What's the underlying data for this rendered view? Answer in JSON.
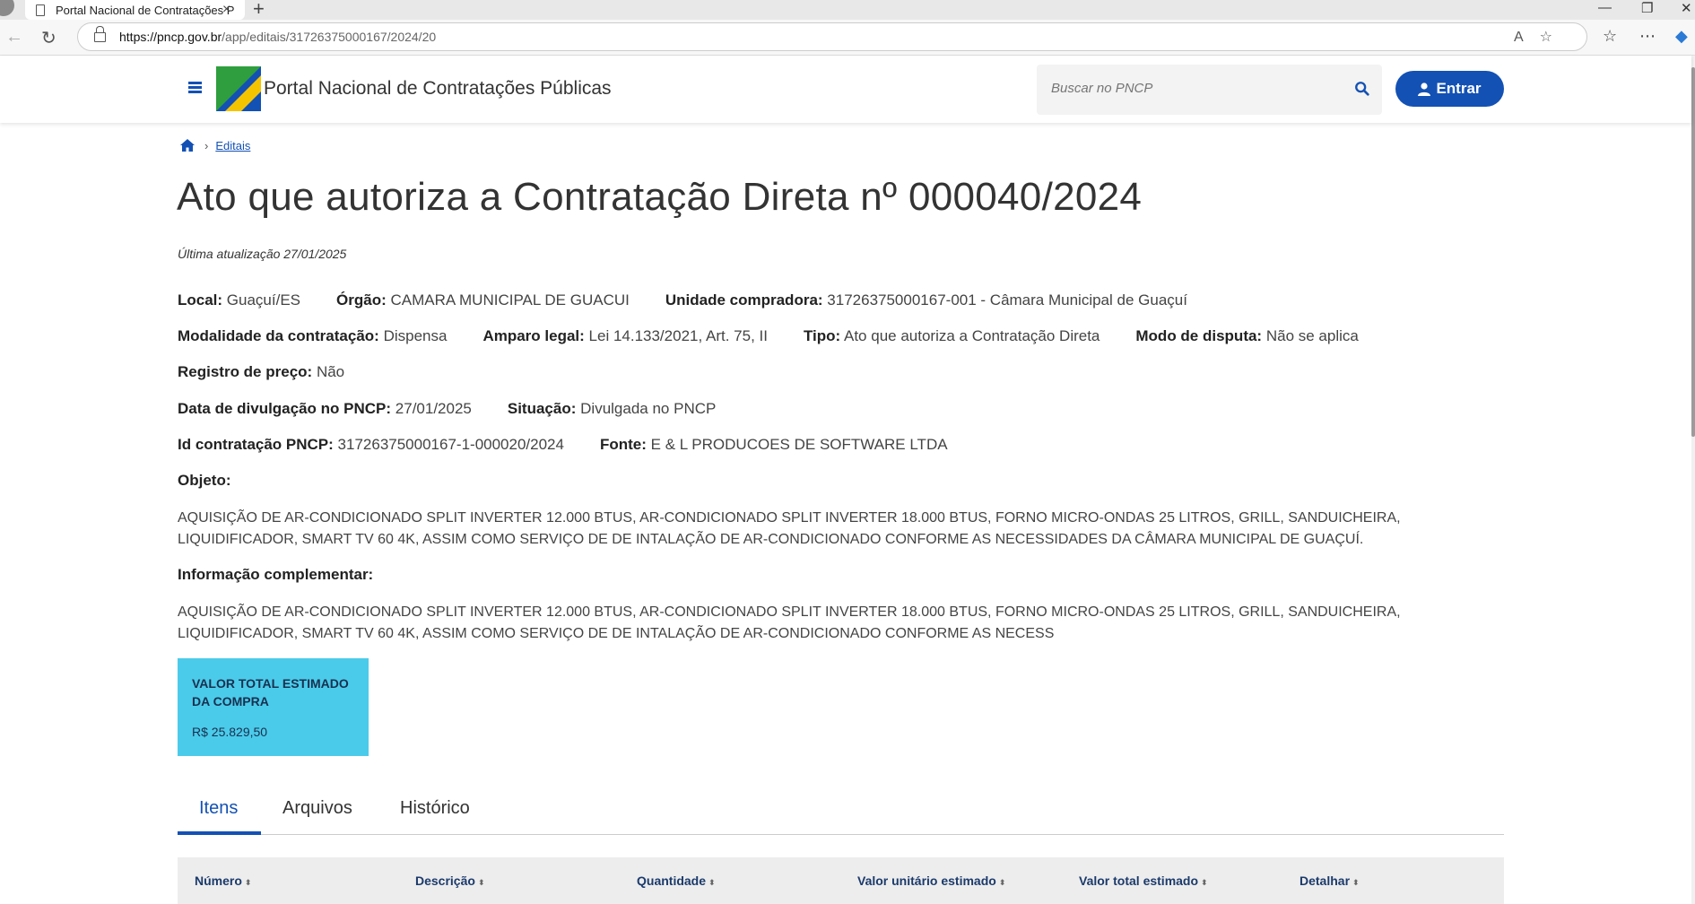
{
  "browser": {
    "tab_title": "Portal Nacional de Contratações P",
    "url_host": "https://pncp.gov.br",
    "url_path": "/app/editais/31726375000167/2024/20"
  },
  "header": {
    "site_title": "Portal Nacional de Contratações Públicas",
    "search_placeholder": "Buscar no PNCP",
    "login_label": "Entrar"
  },
  "breadcrumb": {
    "item": "Editais"
  },
  "page": {
    "title": "Ato que autoriza a Contratação Direta nº 000040/2024",
    "updated": "Última atualização 27/01/2025"
  },
  "details": {
    "local_label": "Local:",
    "local_value": "Guaçuí/ES",
    "orgao_label": "Órgão:",
    "orgao_value": "CAMARA MUNICIPAL DE GUACUI",
    "unidade_label": "Unidade compradora:",
    "unidade_value": "31726375000167-001 - Câmara Municipal de Guaçuí",
    "modalidade_label": "Modalidade da contratação:",
    "modalidade_value": "Dispensa",
    "amparo_label": "Amparo legal:",
    "amparo_value": "Lei 14.133/2021, Art. 75, II",
    "tipo_label": "Tipo:",
    "tipo_value": "Ato que autoriza a Contratação Direta",
    "modo_label": "Modo de disputa:",
    "modo_value": "Não se aplica",
    "registro_label": "Registro de preço:",
    "registro_value": "Não",
    "data_label": "Data de divulgação no PNCP:",
    "data_value": "27/01/2025",
    "situacao_label": "Situação:",
    "situacao_value": "Divulgada no PNCP",
    "id_label": "Id contratação PNCP:",
    "id_value": "31726375000167-1-000020/2024",
    "fonte_label": "Fonte:",
    "fonte_value": "E & L PRODUCOES DE SOFTWARE LTDA",
    "objeto_label": "Objeto:",
    "objeto_text": "AQUISIÇÃO DE AR-CONDICIONADO SPLIT INVERTER 12.000 BTUS, AR-CONDICIONADO SPLIT INVERTER 18.000 BTUS, FORNO MICRO-ONDAS 25 LITROS, GRILL, SANDUICHEIRA, LIQUIDIFICADOR, SMART TV 60 4K, ASSIM COMO SERVIÇO DE DE INTALAÇÃO DE AR-CONDICIONADO CONFORME AS NECESSIDADES DA CÂMARA MUNICIPAL DE GUAÇUÍ.",
    "info_label": "Informação complementar:",
    "info_text": "AQUISIÇÃO DE AR-CONDICIONADO SPLIT INVERTER 12.000 BTUS, AR-CONDICIONADO SPLIT INVERTER 18.000 BTUS, FORNO MICRO-ONDAS 25 LITROS, GRILL, SANDUICHEIRA, LIQUIDIFICADOR, SMART TV 60 4K, ASSIM COMO SERVIÇO DE DE INTALAÇÃO DE AR-CONDICIONADO CONFORME AS NECESS"
  },
  "value_card": {
    "label": "VALOR TOTAL ESTIMADO DA COMPRA",
    "value": "R$ 25.829,50"
  },
  "tabs": [
    "Itens",
    "Arquivos",
    "Histórico"
  ],
  "table": {
    "columns": [
      "Número",
      "Descrição",
      "Quantidade",
      "Valor unitário estimado",
      "Valor total estimado",
      "Detalhar"
    ]
  },
  "colors": {
    "primary": "#1351b4",
    "card": "#4bcbea"
  }
}
